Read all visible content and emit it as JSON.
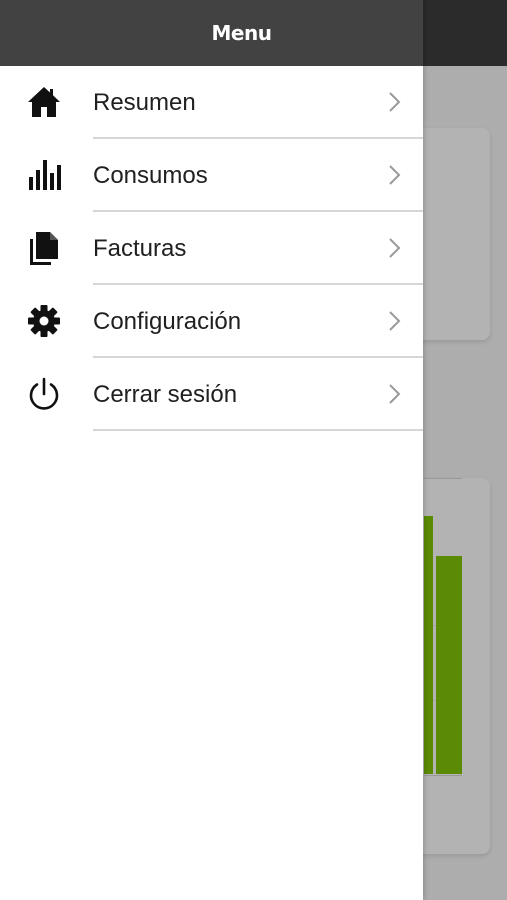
{
  "header": {
    "title": "Menu"
  },
  "menu": {
    "items": [
      {
        "label": "Resumen",
        "icon": "home-icon"
      },
      {
        "label": "Consumos",
        "icon": "bar-chart-icon"
      },
      {
        "label": "Facturas",
        "icon": "documents-icon"
      },
      {
        "label": "Configuración",
        "icon": "gear-icon"
      },
      {
        "label": "Cerrar sesión",
        "icon": "power-icon"
      }
    ]
  },
  "colors": {
    "header_bg": "#424242",
    "drawer_bg": "#ffffff",
    "overlay_bg": "#adadad",
    "chart_bar": "#5b8a05",
    "text": "#202020"
  }
}
